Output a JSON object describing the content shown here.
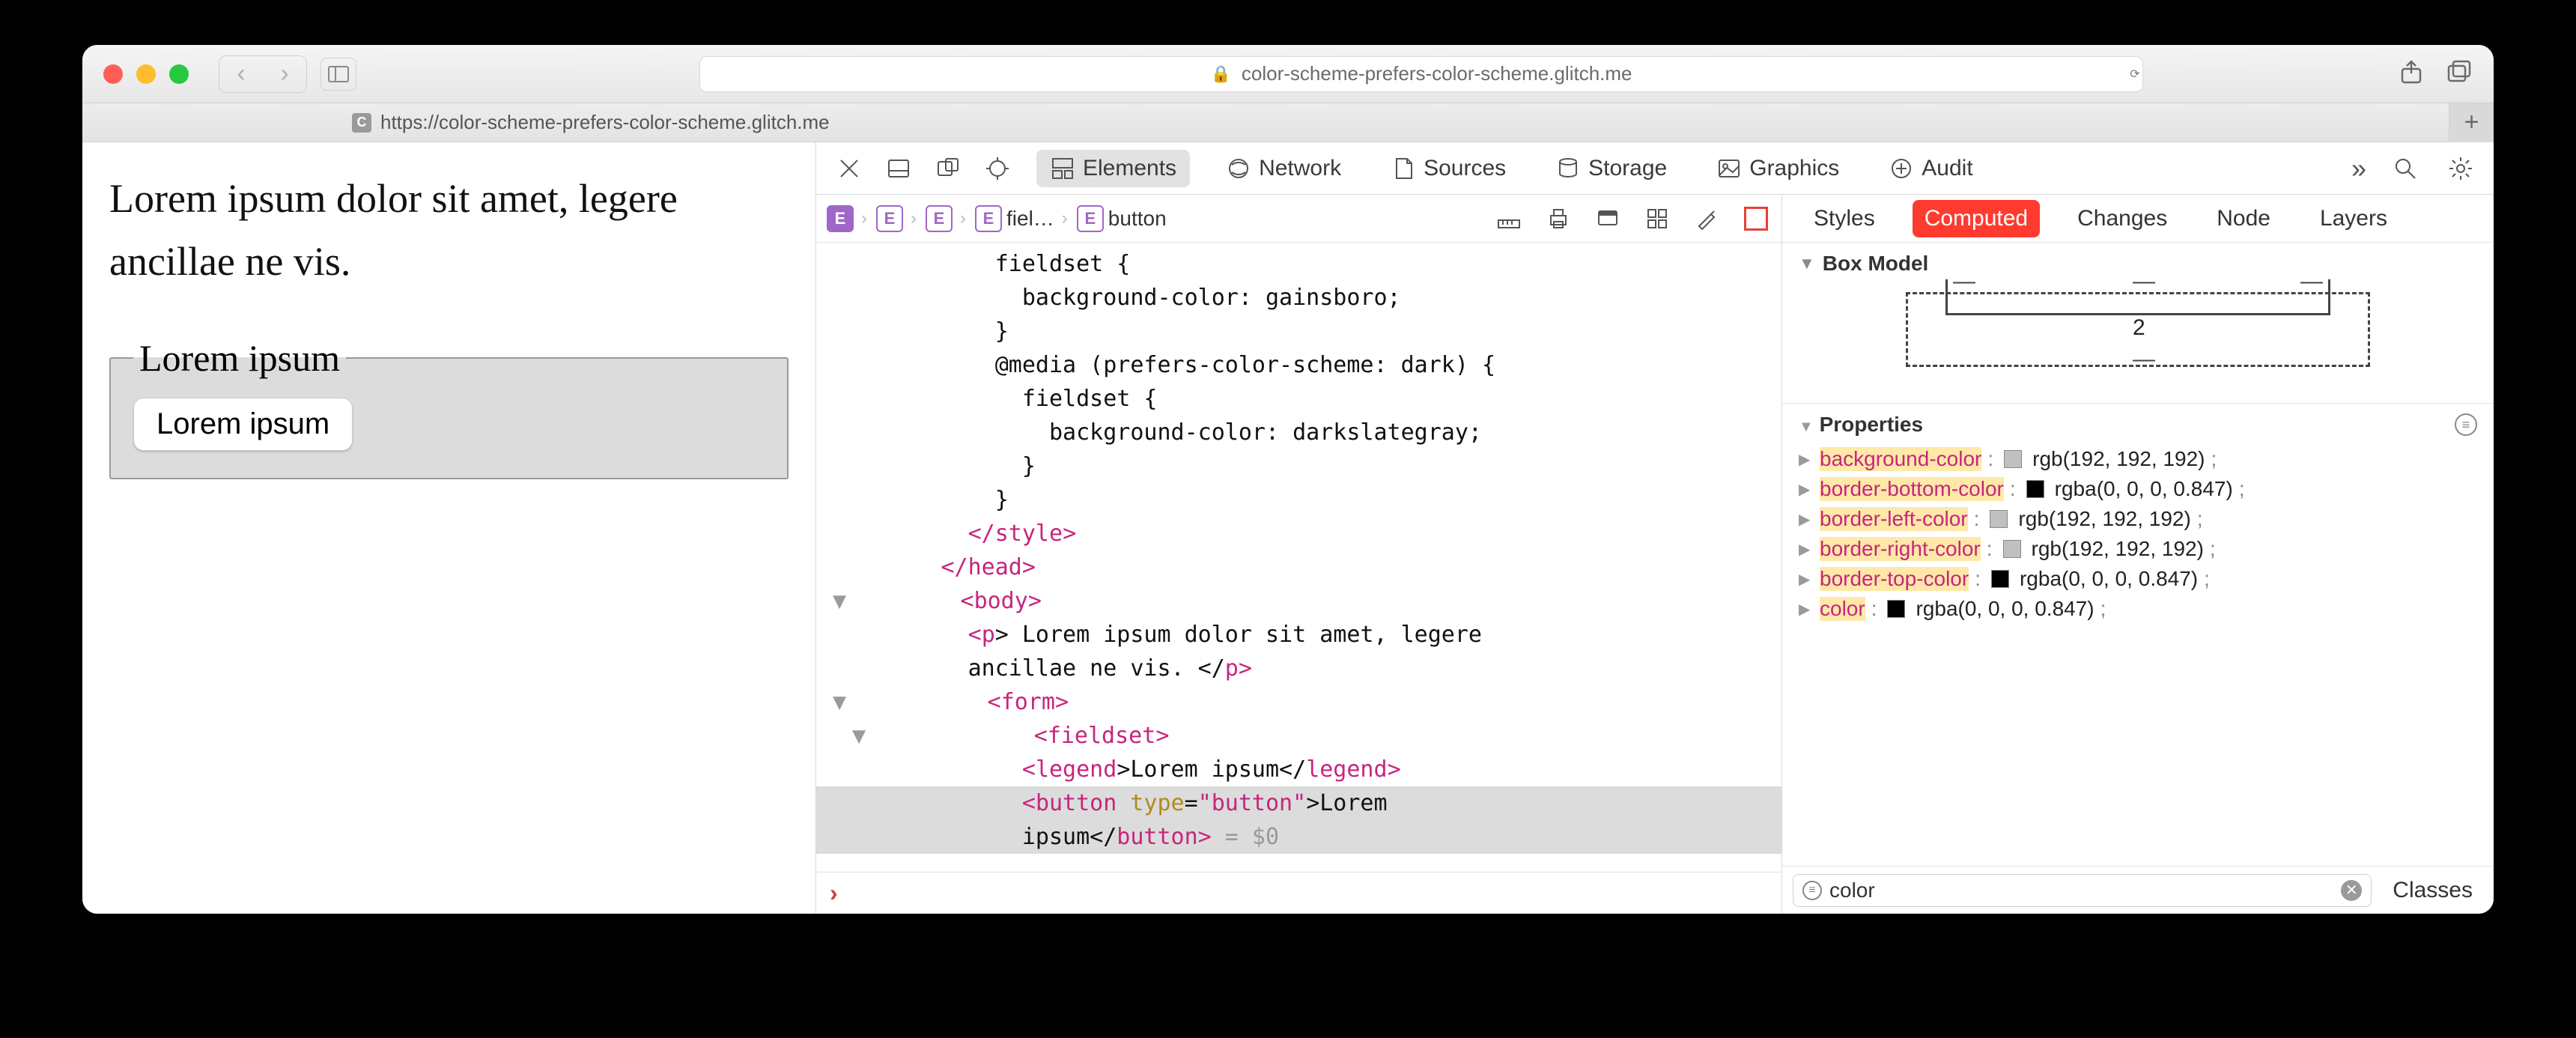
{
  "browser": {
    "url_display": "color-scheme-prefers-color-scheme.glitch.me",
    "tab_url": "https://color-scheme-prefers-color-scheme.glitch.me",
    "tab_favicon_letter": "C"
  },
  "page_content": {
    "paragraph": "Lorem ipsum dolor sit amet, legere ancillae ne vis.",
    "legend": "Lorem ipsum",
    "button_label": "Lorem ipsum"
  },
  "devtools": {
    "panels": {
      "elements": "Elements",
      "network": "Network",
      "sources": "Sources",
      "storage": "Storage",
      "graphics": "Graphics",
      "audit": "Audit"
    },
    "breadcrumbs": {
      "item3_label": "fiel…",
      "item4_label": "button"
    },
    "dom_lines": {
      "l0": "            fieldset {",
      "l1": "              background-color: gainsboro;",
      "l2": "            }",
      "l3": "            @media (prefers-color-scheme: dark) {",
      "l4": "              fieldset {",
      "l5": "                background-color: darkslategray;",
      "l6": "              }",
      "l7": "            }",
      "l8a": "          </",
      "l8b": "style",
      "l8c": ">",
      "l9a": "        </",
      "l9b": "head",
      "l9c": ">",
      "l10a": "        <",
      "l10b": "body",
      "l10c": ">",
      "l11a": "          <",
      "l11b": "p",
      "l11c": "> Lorem ipsum dolor sit amet, legere",
      "l11d": "          ancillae ne vis. </",
      "l11e": "p",
      "l11f": ">",
      "l12a": "          <",
      "l12b": "form",
      "l12c": ">",
      "l13a": "            <",
      "l13b": "fieldset",
      "l13c": ">",
      "l14a": "              <",
      "l14b": "legend",
      "l14c": ">Lorem ipsum</",
      "l14d": "legend",
      "l14e": ">",
      "l15a": "              <",
      "l15b": "button",
      "l15c": " type",
      "l15d": "=",
      "l15e": "\"button\"",
      "l15f": ">Lorem",
      "l16a": "              ipsum</",
      "l16b": "button",
      "l16c": "> ",
      "l16d": "= $0"
    },
    "styles_tabs": {
      "styles": "Styles",
      "computed": "Computed",
      "changes": "Changes",
      "node": "Node",
      "layers": "Layers"
    },
    "box_model": {
      "heading": "Box Model",
      "top_left": "—",
      "top_mid": "—",
      "top_right": "—",
      "value": "2",
      "bottom": "—"
    },
    "properties": {
      "heading": "Properties",
      "rows": [
        {
          "name": "background-color",
          "swatch": "#c0c0c0",
          "value": "rgb(192, 192, 192)"
        },
        {
          "name": "border-bottom-color",
          "swatch": "#000000",
          "value": "rgba(0, 0, 0, 0.847)"
        },
        {
          "name": "border-left-color",
          "swatch": "#c0c0c0",
          "value": "rgb(192, 192, 192)"
        },
        {
          "name": "border-right-color",
          "swatch": "#c0c0c0",
          "value": "rgb(192, 192, 192)"
        },
        {
          "name": "border-top-color",
          "swatch": "#000000",
          "value": "rgba(0, 0, 0, 0.847)"
        },
        {
          "name": "color",
          "swatch": "#000000",
          "value": "rgba(0, 0, 0, 0.847)"
        }
      ]
    },
    "filter": {
      "value": "color",
      "classes_label": "Classes"
    }
  }
}
